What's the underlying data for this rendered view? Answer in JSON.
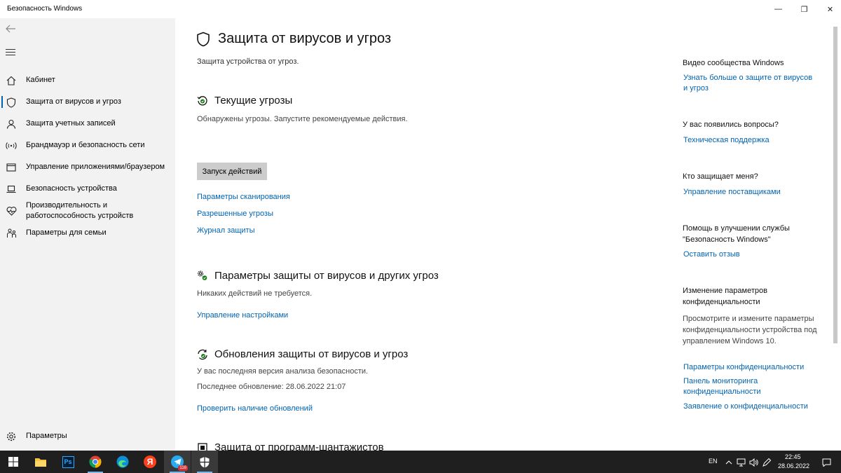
{
  "window": {
    "title": "Безопасность Windows",
    "controls": {
      "minimize": "—",
      "maximize": "❐",
      "close": "✕"
    }
  },
  "sidebar": {
    "items": [
      {
        "label": "Кабинет",
        "icon": "home-icon",
        "active": false
      },
      {
        "label": "Защита от вирусов и угроз",
        "icon": "shield-icon",
        "active": true
      },
      {
        "label": "Защита учетных записей",
        "icon": "person-icon",
        "active": false
      },
      {
        "label": "Брандмауэр и безопасность сети",
        "icon": "wifi-antenna-icon",
        "active": false
      },
      {
        "label": "Управление приложениями/браузером",
        "icon": "browser-window-icon",
        "active": false
      },
      {
        "label": "Безопасность устройства",
        "icon": "laptop-icon",
        "active": false
      },
      {
        "label": "Производительность и\nработоспособность устройств",
        "icon": "heart-pulse-icon",
        "active": false
      },
      {
        "label": "Параметры для семьи",
        "icon": "family-icon",
        "active": false
      }
    ],
    "settings_label": "Параметры"
  },
  "main": {
    "title": "Защита от вирусов и угроз",
    "subtitle": "Защита устройства от угроз.",
    "current_threats": {
      "title": "Текущие угрозы",
      "text": "Обнаружены угрозы. Запустите рекомендуемые действия.",
      "button": "Запуск действий",
      "links": [
        "Параметры сканирования",
        "Разрешенные угрозы",
        "Журнал защиты"
      ]
    },
    "protection_settings": {
      "title": "Параметры защиты от вирусов и других угроз",
      "text": "Никаких действий не требуется.",
      "link": "Управление настройками"
    },
    "updates": {
      "title": "Обновления защиты от вирусов и угроз",
      "text": "У вас последняя версия анализа безопасности.",
      "last_update": "Последнее обновление: 28.06.2022 21:07",
      "link": "Проверить наличие обновлений"
    },
    "ransomware": {
      "title": "Защита от программ-шантажистов"
    }
  },
  "right": {
    "community": {
      "title": "Видео сообщества Windows",
      "link": "Узнать больше о защите от вирусов и угроз"
    },
    "questions": {
      "title": "У вас появились вопросы?",
      "link": "Техническая поддержка"
    },
    "who_protects": {
      "title": "Кто защищает меня?",
      "link": "Управление поставщиками"
    },
    "improve": {
      "title": "Помощь в улучшении службы \"Безопасность Windows\"",
      "link": "Оставить отзыв"
    },
    "privacy": {
      "title": "Изменение параметров конфиденциальности",
      "text": "Просмотрите и измените параметры конфиденциальности устройства под управлением Windows 10.",
      "links": [
        "Параметры конфиденциальности",
        "Панель мониторинга конфиденциальности",
        "Заявление о конфиденциальности"
      ]
    }
  },
  "taskbar": {
    "apps": [
      "start-icon",
      "file-explorer-icon",
      "photoshop-icon",
      "chrome-icon",
      "edge-icon",
      "yandex-browser-icon",
      "telegram-icon",
      "windows-security-icon"
    ],
    "ps_label": "Ps",
    "yandex_label": "Я",
    "telegram_badge": "116",
    "language": "EN",
    "time": "22:45",
    "date": "28.06.2022"
  },
  "colors": {
    "accent": "#0063b1",
    "sidebar_bg": "#f2f2f2",
    "taskbar_bg": "#1f1f1f",
    "button_bg": "#cccccc"
  }
}
